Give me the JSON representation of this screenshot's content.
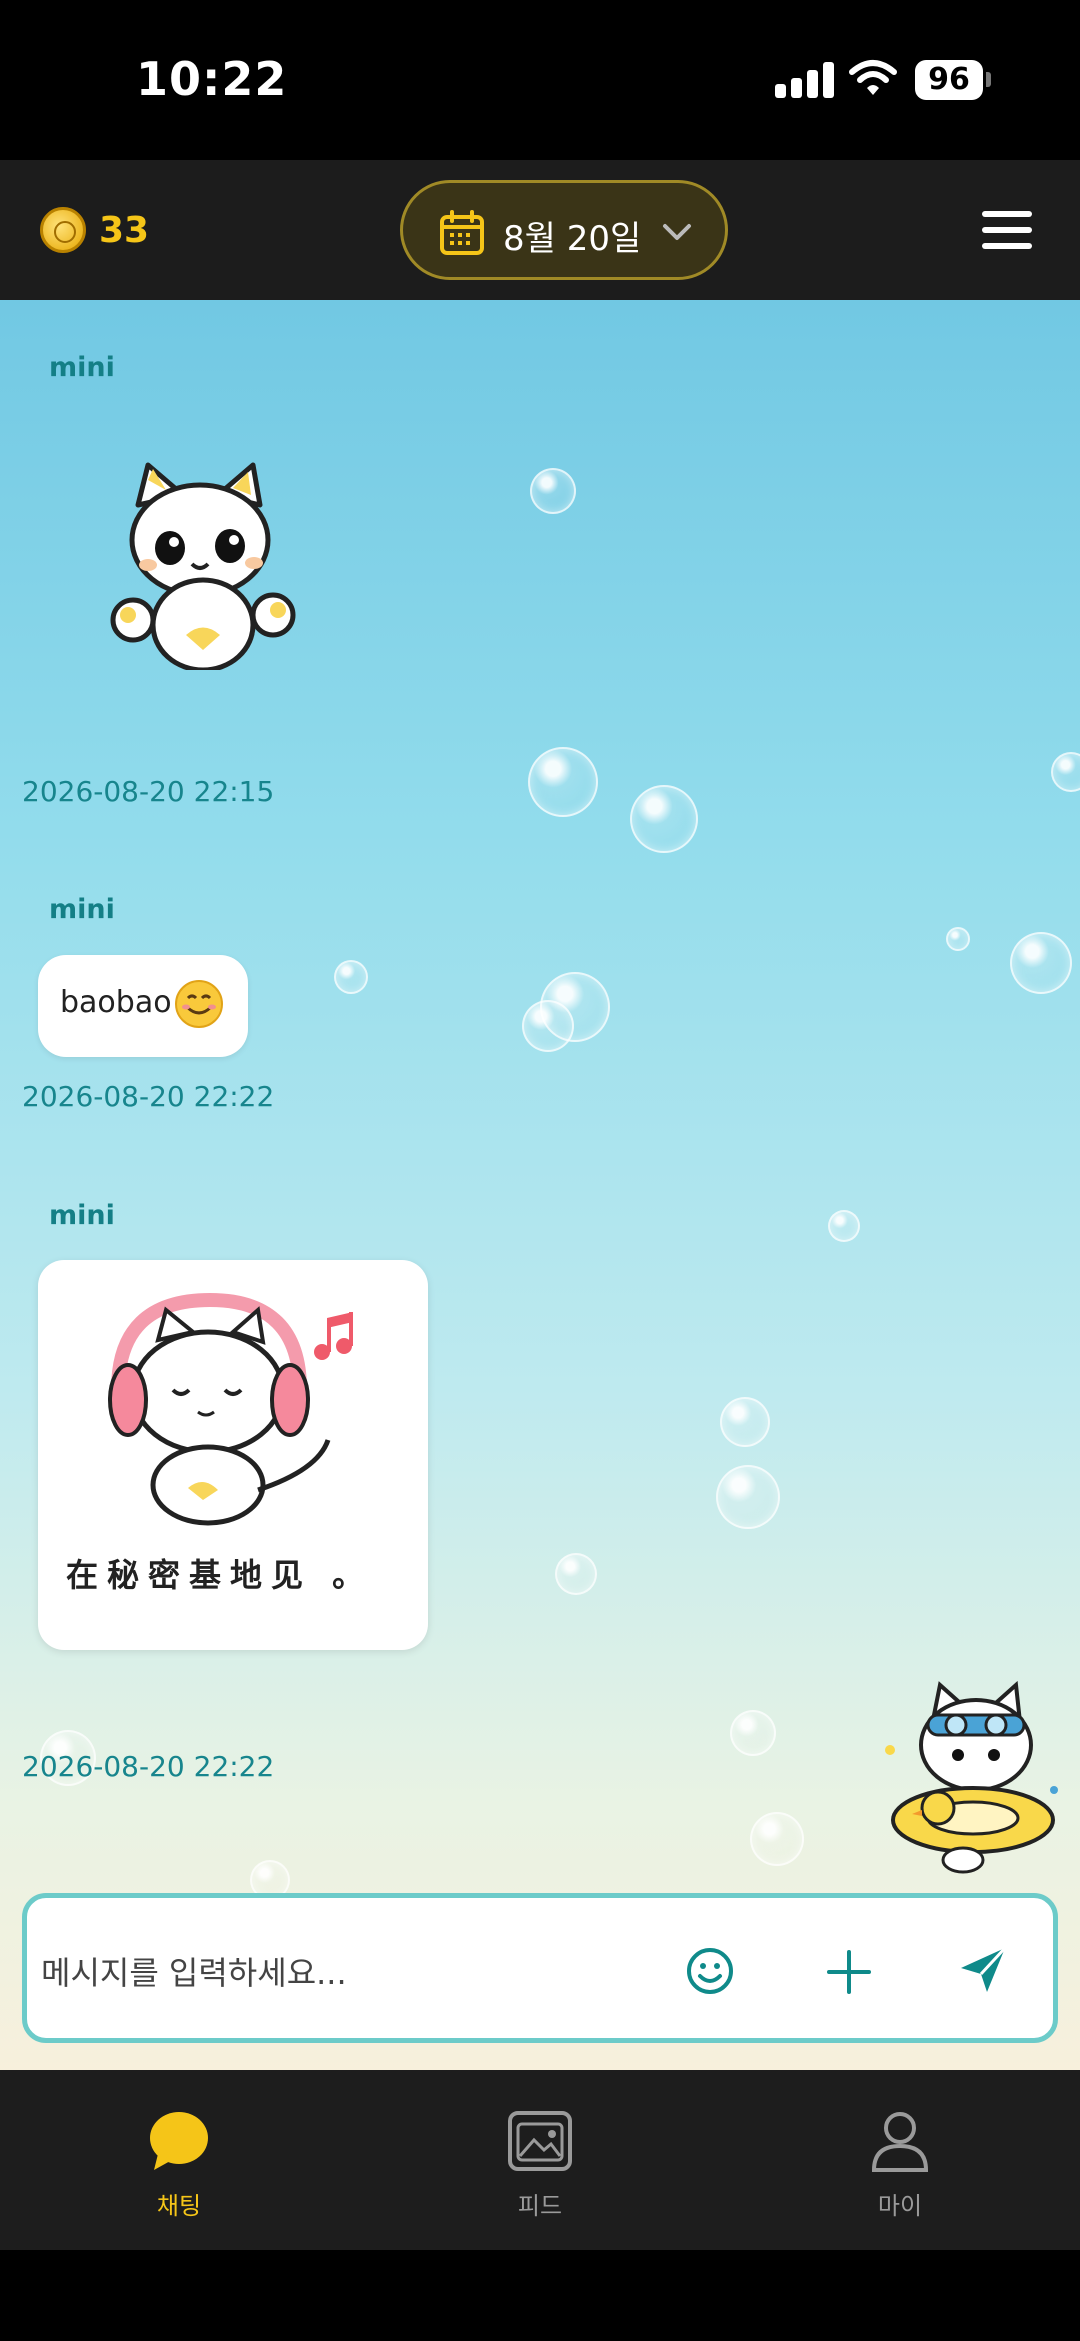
{
  "status_bar": {
    "time": "10:22",
    "battery": "96"
  },
  "header": {
    "coin_count": "33",
    "date_label": "8월 20일",
    "icons": [
      "coin-icon",
      "calendar-icon",
      "chevron-down-icon",
      "menu-icon"
    ]
  },
  "messages": [
    {
      "sender": "mini",
      "type": "sticker",
      "sticker": "cat-thumbs-up",
      "timestamp": "2026-08-20 22:15"
    },
    {
      "sender": "mini",
      "type": "text",
      "text": "baobao",
      "emoji": "smiling-face",
      "timestamp": "2026-08-20 22:22"
    },
    {
      "sender": "mini",
      "type": "image",
      "image": "cat-headphones",
      "caption": "在秘密基地见 。",
      "timestamp": "2026-08-20 22:22"
    }
  ],
  "input": {
    "placeholder": "메시지를 입력하세요..."
  },
  "bottom_nav": {
    "items": [
      {
        "label": "채팅",
        "icon": "chat-bubble-icon",
        "active": true
      },
      {
        "label": "피드",
        "icon": "gallery-icon",
        "active": false
      },
      {
        "label": "마이",
        "icon": "person-icon",
        "active": false
      }
    ]
  },
  "colors": {
    "accent_yellow": "#f5c518",
    "teal_text": "#147f86",
    "input_border": "#6ccbc9",
    "send_icon": "#0f8a8a"
  }
}
